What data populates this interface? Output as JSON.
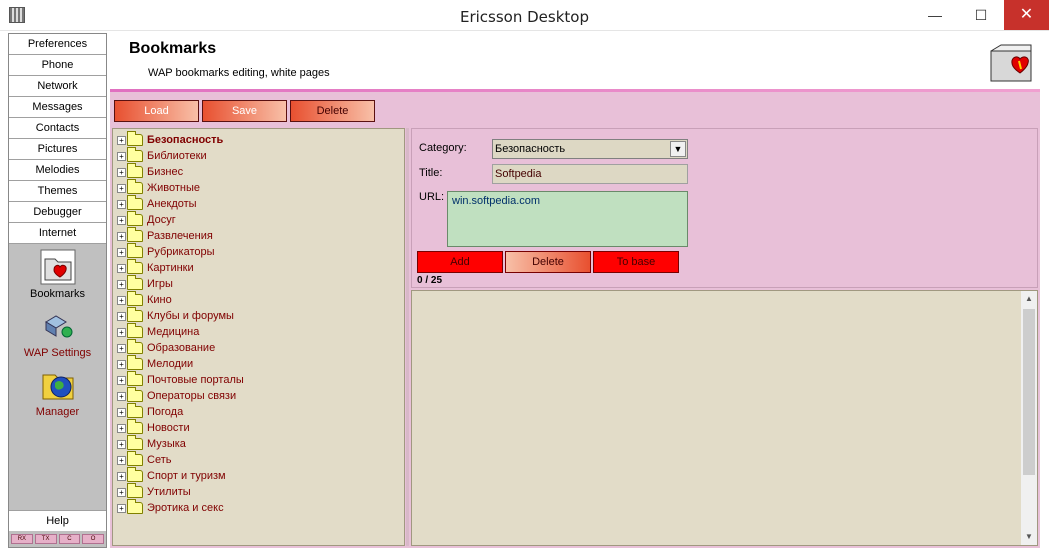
{
  "window": {
    "title": "Ericsson Desktop",
    "min": "—",
    "max": "☐",
    "close": "✕"
  },
  "sidebar": {
    "nav": [
      "Preferences",
      "Phone",
      "Network",
      "Messages",
      "Contacts",
      "Pictures",
      "Melodies",
      "Themes",
      "Debugger",
      "Internet"
    ],
    "tools": [
      {
        "label": "Bookmarks",
        "icon": "bookmarks-folder-icon"
      },
      {
        "label": "WAP Settings",
        "icon": "wap-settings-icon"
      },
      {
        "label": "Manager",
        "icon": "globe-folder-icon"
      }
    ],
    "help": "Help",
    "leds": [
      "RX",
      "TX",
      "C",
      "O"
    ]
  },
  "header": {
    "title": "Bookmarks",
    "subtitle": "WAP bookmarks editing, white pages"
  },
  "toolbar": {
    "load": "Load",
    "save": "Save",
    "delete": "Delete"
  },
  "tree": {
    "items": [
      "Безопасность",
      "Библиотеки",
      "Бизнес",
      "Животные",
      "Анекдоты",
      "Досуг",
      "Развлечения",
      "Рубрикаторы",
      "Картинки",
      "Игры",
      "Кино",
      "Клубы и форумы",
      "Медицина",
      "Образование",
      "Мелодии",
      "Почтовые порталы",
      "Операторы связи",
      "Погода",
      "Новости",
      "Музыка",
      "Сеть",
      "Спорт и туризм",
      "Утилиты",
      "Эротика и секс"
    ],
    "selected_index": 0
  },
  "form": {
    "category_label": "Category:",
    "category_value": "Безопасность",
    "title_label": "Title:",
    "title_value": "Softpedia",
    "url_label": "URL:",
    "url_value": "win.softpedia.com",
    "add": "Add",
    "delete": "Delete",
    "tobase": "To base",
    "counter": "0 / 25"
  },
  "colors": {
    "accent": "#e8c0d8",
    "button_red": "#ff0000",
    "tree_text": "#800000",
    "panel_bg": "#e2dcc8"
  }
}
